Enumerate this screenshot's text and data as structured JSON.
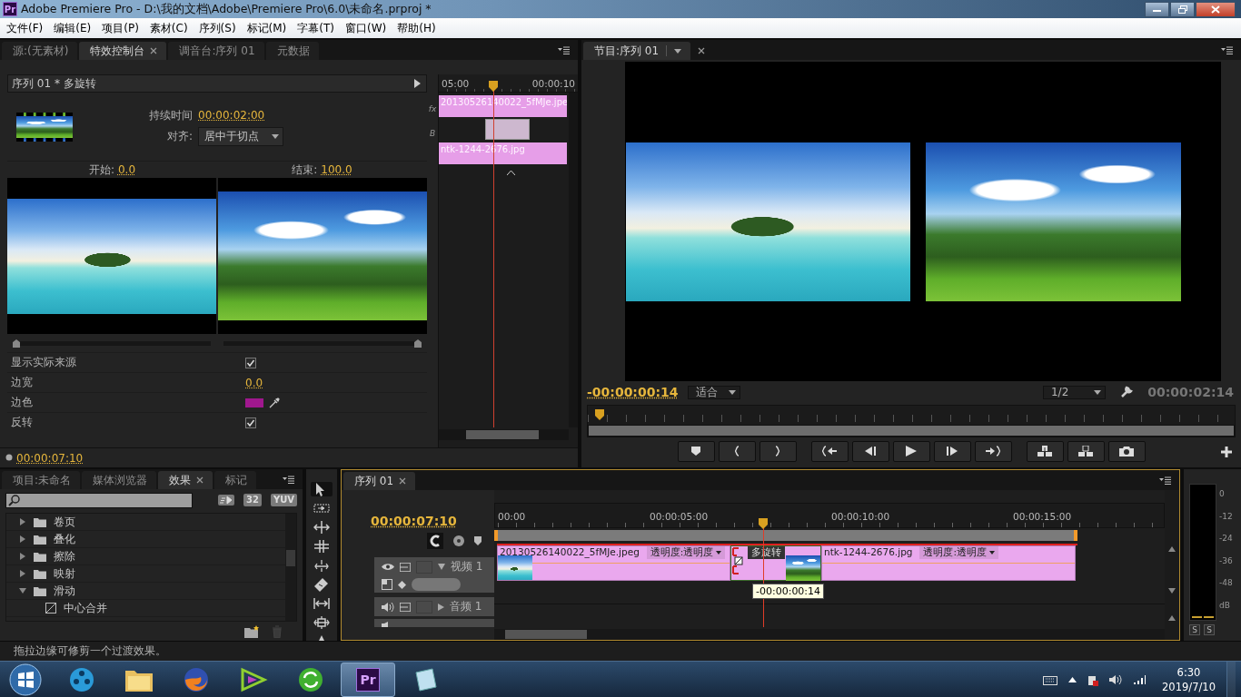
{
  "window": {
    "logo": "Pr",
    "title": "Adobe Premiere Pro - D:\\我的文档\\Adobe\\Premiere Pro\\6.0\\未命名.prproj *"
  },
  "menu": [
    "文件(F)",
    "编辑(E)",
    "项目(P)",
    "素材(C)",
    "序列(S)",
    "标记(M)",
    "字幕(T)",
    "窗口(W)",
    "帮助(H)"
  ],
  "effect_controls": {
    "tabs": [
      {
        "label": "源:(无素材)",
        "selected": false,
        "closable": false
      },
      {
        "label": "特效控制台",
        "selected": true,
        "closable": true
      },
      {
        "label": "调音台:序列 01",
        "selected": false,
        "closable": false
      },
      {
        "label": "元数据",
        "selected": false,
        "closable": false
      }
    ],
    "header": "序列 01 * 多旋转",
    "duration_label": "持续时间",
    "duration": "00:00:02:00",
    "alignment_label": "对齐:",
    "alignment": "居中于切点",
    "start_label": "开始:",
    "start": "0.0",
    "end_label": "结束:",
    "end": "100.0",
    "start_slider": {
      "level": 0
    },
    "end_slider": {
      "level": 1
    },
    "properties": [
      {
        "kind": "checkbox",
        "label": "显示实际来源",
        "checked": true
      },
      {
        "kind": "number",
        "label": "边宽",
        "value": "0.0"
      },
      {
        "kind": "color",
        "label": "边色",
        "color": "#a0188e"
      },
      {
        "kind": "checkbox",
        "label": "反转",
        "checked": true
      }
    ],
    "mini_timeline": {
      "ruler": [
        "05:00",
        "00:00:10"
      ],
      "track_labels": [
        "fx",
        "B"
      ],
      "clip_a": "20130526140022_5fMJe.jpe",
      "clip_b": "ntk-1244-2676.jpg"
    },
    "timecode": "00:00:07:10"
  },
  "program_monitor": {
    "tab": "节目:序列 01",
    "timecode": "-00:00:00:14",
    "zoom": "适合",
    "resolution": "1/2",
    "duration": "00:00:02:14"
  },
  "project_panel": {
    "tabs": [
      {
        "label": "项目:未命名",
        "selected": false,
        "closable": false
      },
      {
        "label": "媒体浏览器",
        "selected": false,
        "closable": false
      },
      {
        "label": "效果",
        "selected": true,
        "closable": true
      },
      {
        "label": "标记",
        "selected": false,
        "closable": false
      }
    ],
    "badges": [
      "32",
      "YUV"
    ],
    "tree": [
      {
        "label": "卷页",
        "expanded": false
      },
      {
        "label": "叠化",
        "expanded": false
      },
      {
        "label": "擦除",
        "expanded": false
      },
      {
        "label": "映射",
        "expanded": false
      },
      {
        "label": "滑动",
        "expanded": true,
        "children": [
          {
            "label": "中心合并"
          }
        ]
      }
    ]
  },
  "timeline": {
    "tab": "序列 01",
    "timecode": "00:00:07:10",
    "ruler": [
      "00:00",
      "00:00:05:00",
      "00:00:10:00",
      "00:00:15:00"
    ],
    "tracks": [
      {
        "kind": "video",
        "label": "视频 1"
      },
      {
        "kind": "audio",
        "label": "音频 1"
      }
    ],
    "clips": [
      {
        "kind": "clip",
        "name": "20130526140022_5fMJe.jpeg",
        "effect": "透明度:透明度"
      },
      {
        "kind": "transition",
        "name": "多旋转"
      },
      {
        "kind": "clip",
        "name": "ntk-1244-2676.jpg",
        "effect": "透明度:透明度"
      }
    ],
    "tooltip": "-00:00:00:14"
  },
  "audio_meter": {
    "scale": [
      "0",
      "-12",
      "-24",
      "-36",
      "-48",
      "dB"
    ],
    "solo_buttons": [
      "S",
      "S"
    ]
  },
  "status_bar": "拖拉边缘可修剪一个过渡效果。",
  "taskbar": {
    "apps": [
      {
        "kind": "media",
        "selected": false
      },
      {
        "kind": "folder",
        "selected": false
      },
      {
        "kind": "browser",
        "selected": false
      },
      {
        "kind": "editor",
        "selected": false
      },
      {
        "kind": "sync",
        "selected": false
      },
      {
        "kind": "premiere",
        "label": "Pr",
        "selected": true
      },
      {
        "kind": "notes",
        "selected": false
      }
    ],
    "time": "6:30",
    "date": "2019/7/10"
  }
}
